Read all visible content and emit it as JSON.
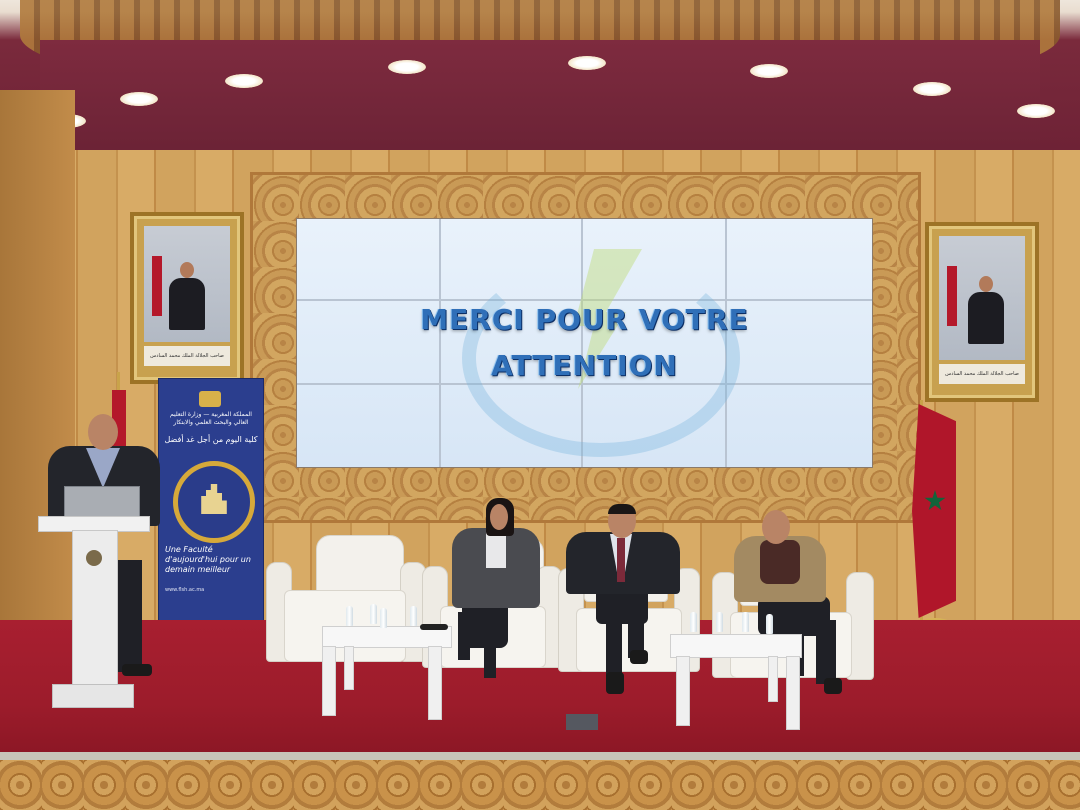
{
  "scene": {
    "slide": {
      "line1": "MERCI POUR VOTRE",
      "line2": "ATTENTION",
      "text_color": "#2f6fb8"
    },
    "banner": {
      "header": "المملكة المغربية — وزارة التعليم العالي والبحث العلمي والابتكار",
      "arabic_title": "كلية اليوم من أجل غد أفضل",
      "tagline": "Une Faculté d'aujourd'hui pour un demain meilleur",
      "footer": "www.flsh.ac.ma",
      "background": "#2b3e8e",
      "accent": "#d6a93a"
    },
    "portrait_caption": "صاحب الجلالة الملك محمد السادس نصره الله",
    "colors": {
      "stage": "#a81f30",
      "wall": "#d1a35e",
      "ceiling": "#6e2236",
      "flag": "#b0162a",
      "flag_star": "#12643a"
    }
  }
}
